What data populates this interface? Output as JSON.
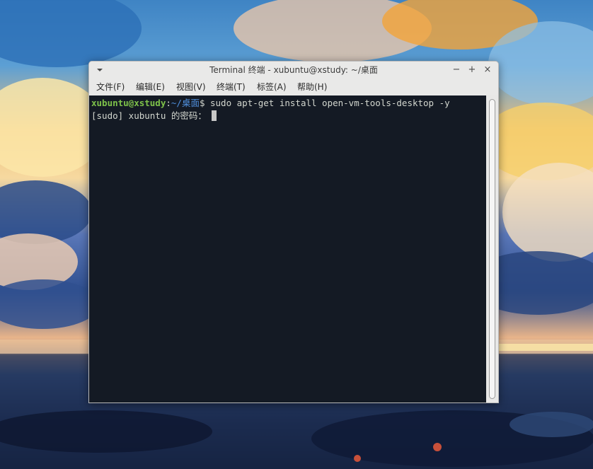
{
  "window": {
    "title": "Terminal 终端 - xubuntu@xstudy: ~/桌面",
    "menu_icon": "chevron-down-icon",
    "minimize_glyph": "−",
    "maximize_glyph": "+",
    "close_glyph": "×"
  },
  "menubar": {
    "items": [
      {
        "label": "文件(F)"
      },
      {
        "label": "编辑(E)"
      },
      {
        "label": "视图(V)"
      },
      {
        "label": "终端(T)"
      },
      {
        "label": "标签(A)"
      },
      {
        "label": "帮助(H)"
      }
    ]
  },
  "terminal": {
    "lines": [
      {
        "prompt_user": "xubuntu@xstudy",
        "prompt_colon": ":",
        "prompt_path": "~/桌面",
        "prompt_symbol": "$",
        "command": " sudo apt-get install open-vm-tools-desktop -y"
      },
      {
        "text": "[sudo] xubuntu 的密码： "
      }
    ],
    "colors": {
      "background": "#141a24",
      "foreground": "#d3d7cf",
      "user": "#7ec24a",
      "path": "#4f8fdc"
    }
  }
}
